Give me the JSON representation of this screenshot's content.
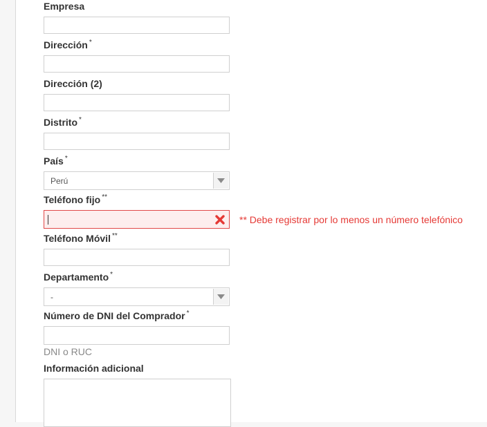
{
  "form": {
    "empresa": {
      "label": "Empresa",
      "value": ""
    },
    "direccion": {
      "label": "Dirección",
      "req": "*",
      "value": ""
    },
    "direccion2": {
      "label": "Dirección (2)",
      "value": ""
    },
    "distrito": {
      "label": "Distrito",
      "req": "*",
      "value": ""
    },
    "pais": {
      "label": "País",
      "req": "*",
      "value": "Perú"
    },
    "telefono_fijo": {
      "label": "Teléfono fijo",
      "req": "**",
      "value": "",
      "error": "** Debe registrar por lo menos un número telefónico"
    },
    "telefono_movil": {
      "label": "Teléfono Móvil",
      "req": "**",
      "value": ""
    },
    "departamento": {
      "label": "Departamento",
      "req": "*",
      "value": "-"
    },
    "dni": {
      "label": "Número de DNI del Comprador",
      "req": "*",
      "value": "",
      "help": "DNI o RUC"
    },
    "info_adicional": {
      "label": "Información adicional",
      "value": ""
    }
  },
  "colors": {
    "error": "#e53935",
    "error_bg": "#fdeeee",
    "border": "#cfcfcf",
    "label": "#333333"
  },
  "icons": {
    "select_arrow": "chevron-down-icon",
    "error_clear": "close-x-icon"
  }
}
